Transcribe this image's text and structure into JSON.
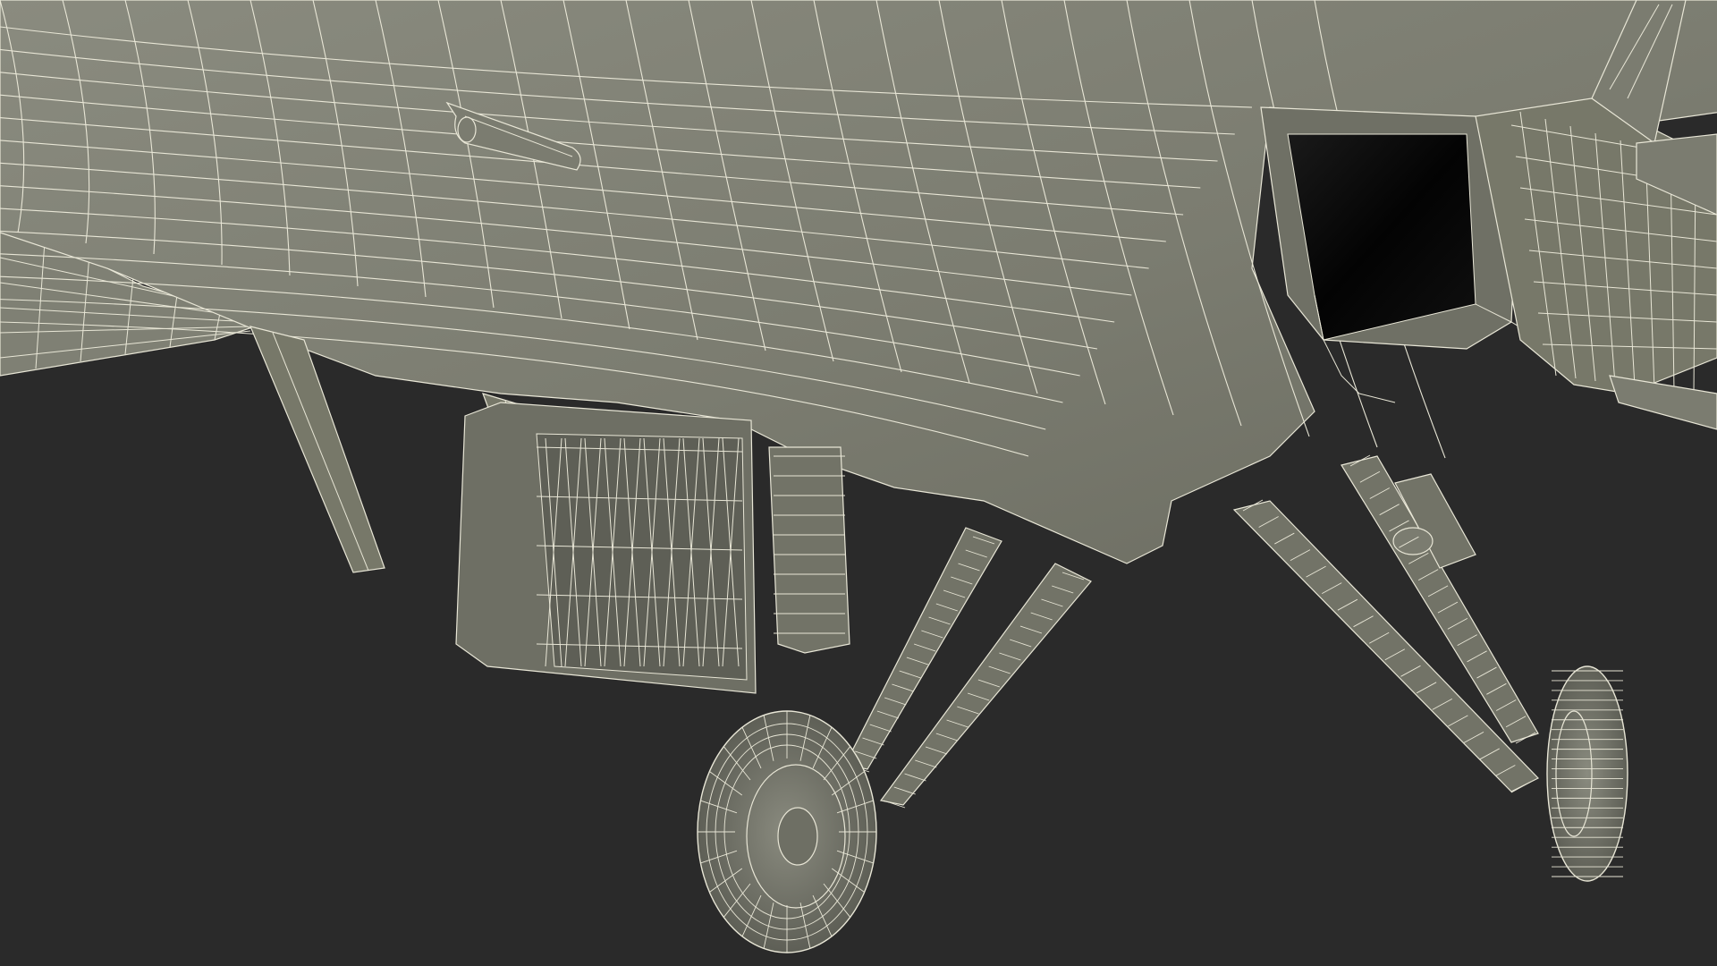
{
  "scene": {
    "subject": "aircraft-underside-wireframe",
    "render_style": "wireframe",
    "colors": {
      "background": "#2a2a2a",
      "surface": "#7d7e72",
      "surface_dark": "#5e5f56",
      "surface_light": "#8b8c80",
      "wire": "#e8e6d6",
      "cavity": "#050505"
    },
    "parts": [
      "fuselage",
      "air-intake",
      "tail-fin",
      "horizontal-stabilizer",
      "antenna",
      "wing-pylon",
      "gear-bay-door",
      "landing-gear-left",
      "landing-gear-right",
      "wheel-left",
      "wheel-right"
    ]
  }
}
